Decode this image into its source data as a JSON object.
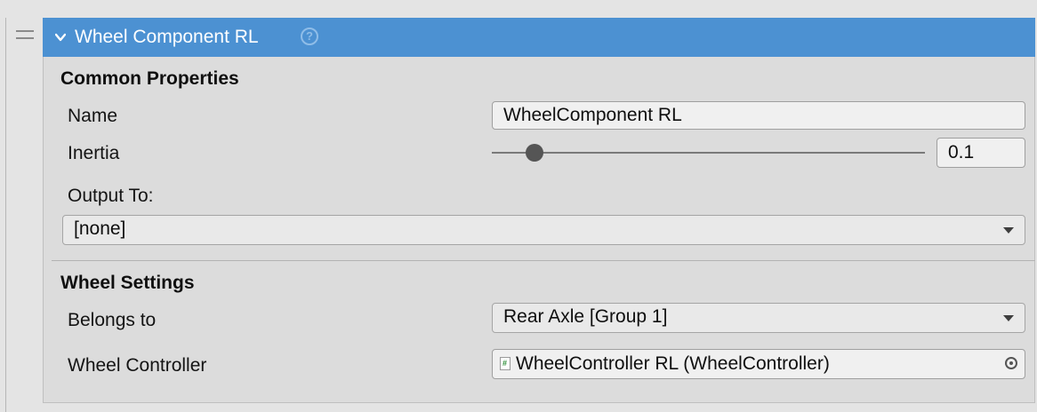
{
  "component": {
    "title": "Wheel Component RL",
    "help_icon_glyph": "?"
  },
  "common": {
    "section_title": "Common Properties",
    "name_label": "Name",
    "name_value": "WheelComponent RL",
    "inertia_label": "Inertia",
    "inertia_value": "0.1",
    "inertia_slider_fraction": 0.1,
    "output_label": "Output To:",
    "output_value": "[none]"
  },
  "wheel": {
    "section_title": "Wheel Settings",
    "belongs_label": "Belongs to",
    "belongs_value": "Rear Axle [Group 1]",
    "controller_label": "Wheel Controller",
    "controller_value": "WheelController RL (WheelController)",
    "script_icon_glyph": "#"
  },
  "colors": {
    "header_blue": "#4c91d2",
    "panel_bg": "#dcdcdc"
  }
}
